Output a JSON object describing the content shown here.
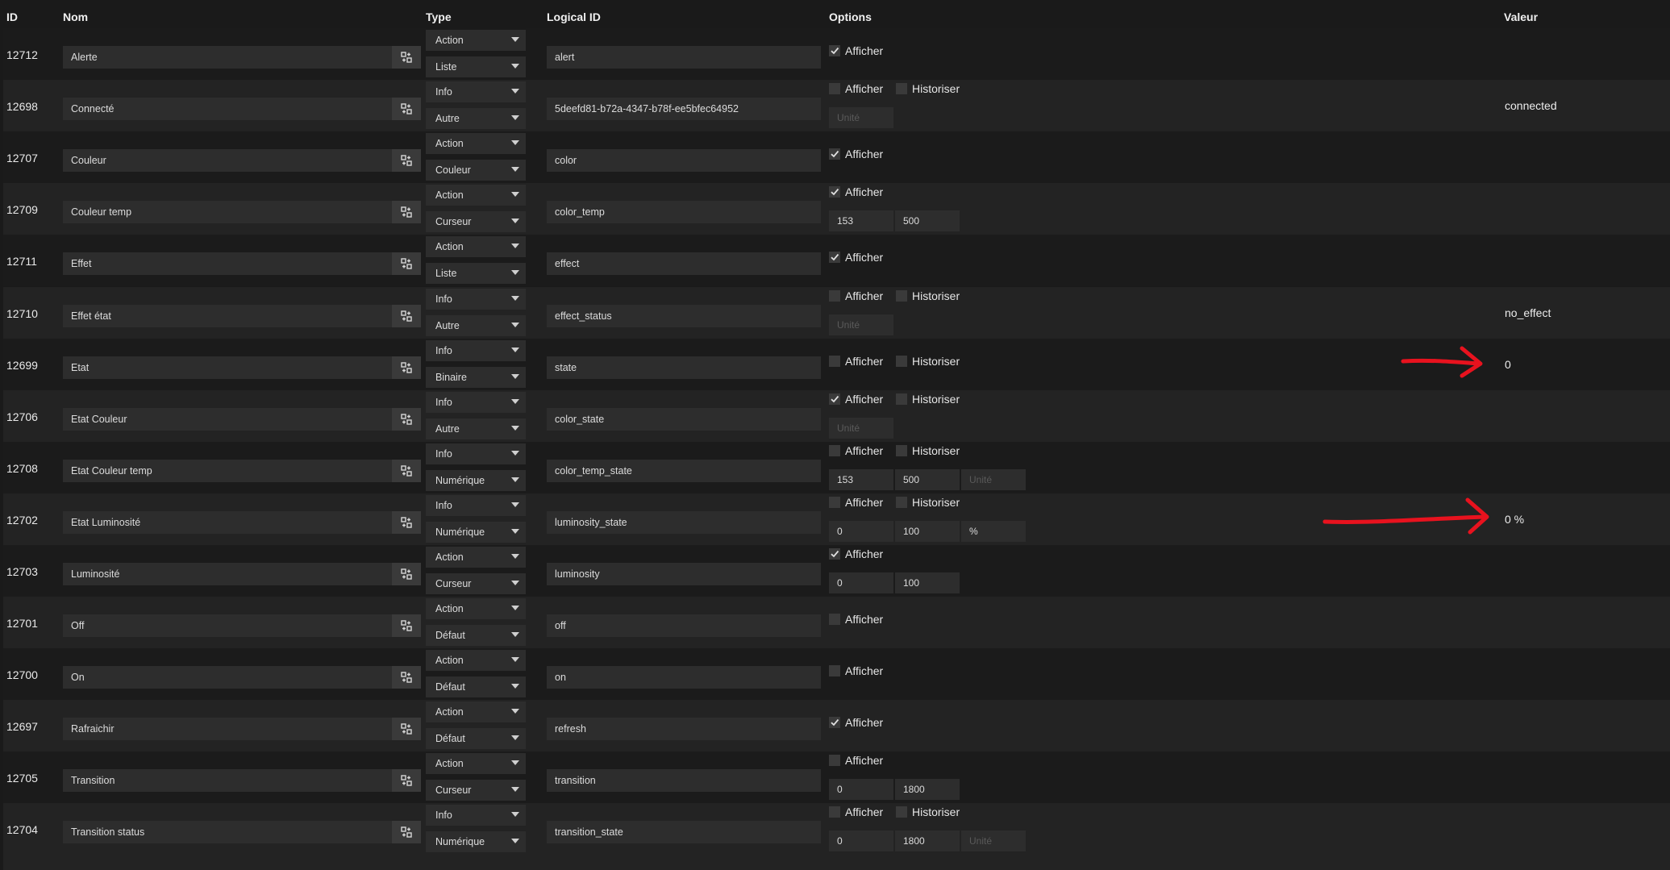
{
  "headers": {
    "id": "ID",
    "nom": "Nom",
    "type": "Type",
    "logical": "Logical ID",
    "options": "Options",
    "valeur": "Valeur"
  },
  "labels": {
    "afficher": "Afficher",
    "historiser": "Historiser"
  },
  "colors": {
    "background": "#1a1a1a",
    "row_odd": "#232323",
    "row_even": "#1b1b1b",
    "input": "#2d2d2d",
    "annotation": "#e8121e"
  },
  "icons": {
    "configure": "configure-icon",
    "check": "check-icon",
    "caret": "caret-down-icon"
  },
  "rows": [
    {
      "id": "12712",
      "name": "Alerte",
      "type": "Action",
      "subtype": "Liste",
      "logical": "alert",
      "afficher": true,
      "historiser": null,
      "min": null,
      "max": null,
      "unit": null,
      "value": ""
    },
    {
      "id": "12698",
      "name": "Connecté",
      "type": "Info",
      "subtype": "Autre",
      "logical": "5deefd81-b72a-4347-b78f-ee5bfec64952",
      "afficher": false,
      "historiser": false,
      "min": null,
      "max": null,
      "unit": "Unité",
      "value": "connected"
    },
    {
      "id": "12707",
      "name": "Couleur",
      "type": "Action",
      "subtype": "Couleur",
      "logical": "color",
      "afficher": true,
      "historiser": null,
      "min": null,
      "max": null,
      "unit": null,
      "value": ""
    },
    {
      "id": "12709",
      "name": "Couleur temp",
      "type": "Action",
      "subtype": "Curseur",
      "logical": "color_temp",
      "afficher": true,
      "historiser": null,
      "min": "153",
      "max": "500",
      "unit": null,
      "value": ""
    },
    {
      "id": "12711",
      "name": "Effet",
      "type": "Action",
      "subtype": "Liste",
      "logical": "effect",
      "afficher": true,
      "historiser": null,
      "min": null,
      "max": null,
      "unit": null,
      "value": ""
    },
    {
      "id": "12710",
      "name": "Effet état",
      "type": "Info",
      "subtype": "Autre",
      "logical": "effect_status",
      "afficher": false,
      "historiser": false,
      "min": null,
      "max": null,
      "unit": "Unité",
      "value": "no_effect"
    },
    {
      "id": "12699",
      "name": "Etat",
      "type": "Info",
      "subtype": "Binaire",
      "logical": "state",
      "afficher": false,
      "historiser": false,
      "min": null,
      "max": null,
      "unit": null,
      "value": "0"
    },
    {
      "id": "12706",
      "name": "Etat Couleur",
      "type": "Info",
      "subtype": "Autre",
      "logical": "color_state",
      "afficher": true,
      "historiser": false,
      "min": null,
      "max": null,
      "unit": "Unité",
      "value": ""
    },
    {
      "id": "12708",
      "name": "Etat Couleur temp",
      "type": "Info",
      "subtype": "Numérique",
      "logical": "color_temp_state",
      "afficher": false,
      "historiser": false,
      "min": "153",
      "max": "500",
      "unit": "Unité",
      "value": ""
    },
    {
      "id": "12702",
      "name": "Etat Luminosité",
      "type": "Info",
      "subtype": "Numérique",
      "logical": "luminosity_state",
      "afficher": false,
      "historiser": false,
      "min": "0",
      "max": "100",
      "unit": "%",
      "value": "0 %"
    },
    {
      "id": "12703",
      "name": "Luminosité",
      "type": "Action",
      "subtype": "Curseur",
      "logical": "luminosity",
      "afficher": true,
      "historiser": null,
      "min": "0",
      "max": "100",
      "unit": null,
      "value": ""
    },
    {
      "id": "12701",
      "name": "Off",
      "type": "Action",
      "subtype": "Défaut",
      "logical": "off",
      "afficher": false,
      "historiser": null,
      "min": null,
      "max": null,
      "unit": null,
      "value": ""
    },
    {
      "id": "12700",
      "name": "On",
      "type": "Action",
      "subtype": "Défaut",
      "logical": "on",
      "afficher": false,
      "historiser": null,
      "min": null,
      "max": null,
      "unit": null,
      "value": ""
    },
    {
      "id": "12697",
      "name": "Rafraichir",
      "type": "Action",
      "subtype": "Défaut",
      "logical": "refresh",
      "afficher": true,
      "historiser": null,
      "min": null,
      "max": null,
      "unit": null,
      "value": ""
    },
    {
      "id": "12705",
      "name": "Transition",
      "type": "Action",
      "subtype": "Curseur",
      "logical": "transition",
      "afficher": false,
      "historiser": null,
      "min": "0",
      "max": "1800",
      "unit": null,
      "value": ""
    },
    {
      "id": "12704",
      "name": "Transition status",
      "type": "Info",
      "subtype": "Numérique",
      "logical": "transition_state",
      "afficher": false,
      "historiser": false,
      "min": "0",
      "max": "1800",
      "unit": "Unité",
      "value": ""
    }
  ]
}
